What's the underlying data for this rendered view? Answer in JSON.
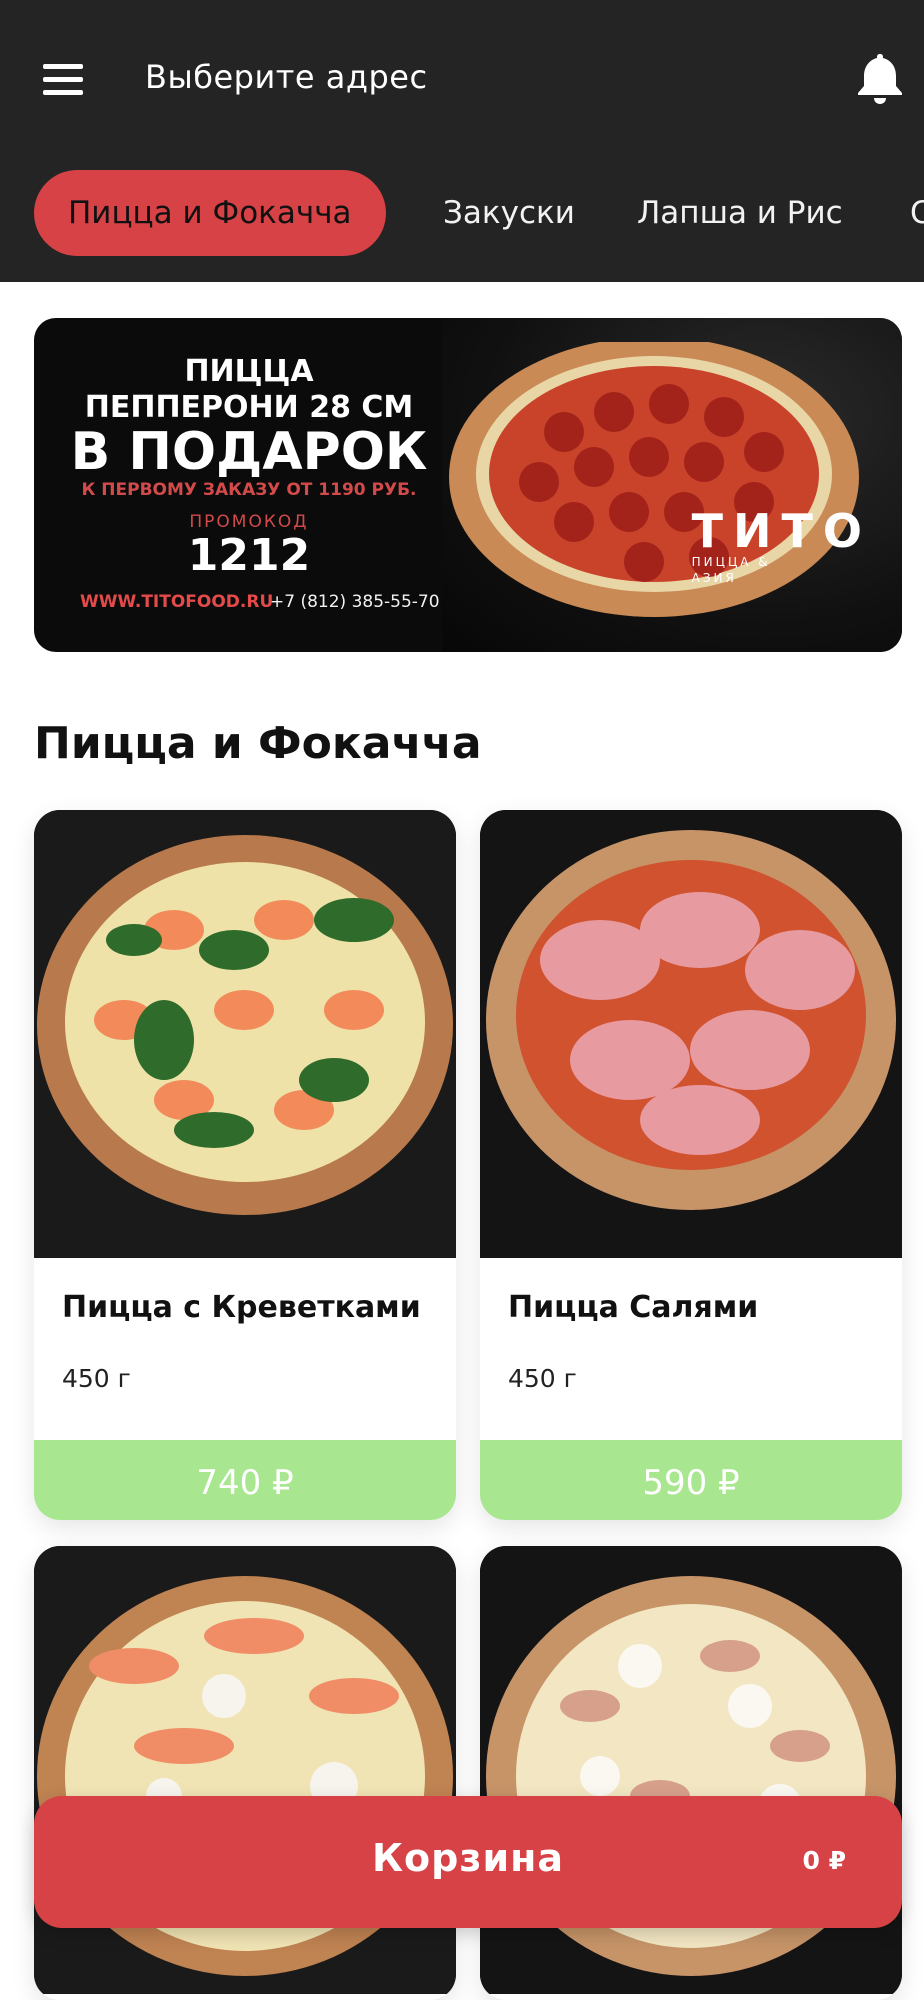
{
  "header": {
    "address_label": "Выберите адрес",
    "menu_icon": "menu-icon",
    "bell_icon": "bell-icon"
  },
  "tabs": [
    {
      "label": "Пицца и Фокачча",
      "active": true
    },
    {
      "label": "Закуски",
      "active": false
    },
    {
      "label": "Лапша и Рис",
      "active": false
    },
    {
      "label": "С",
      "active": false
    }
  ],
  "banner": {
    "line1": "ПИЦЦА",
    "line2": "ПЕППЕРОНИ 28 СМ",
    "line3": "В ПОДАРОК",
    "line4": "К ПЕРВОМУ ЗАКАЗУ ОТ 1190 РУБ.",
    "promo_label": "ПРОМОКОД",
    "promo_code": "1212",
    "website": "WWW.TITOFOOD.RU",
    "phone": "+7 (812) 385-55-70",
    "brand_name": "ТИТО",
    "brand_sub1": "ПИЦЦА &",
    "brand_sub2": "АЗИЯ"
  },
  "section": {
    "title": "Пицца и Фокачча"
  },
  "products": [
    {
      "name": "Пицца с Креветками",
      "weight": "450 г",
      "price": "740 ₽"
    },
    {
      "name": "Пицца Салями",
      "weight": "450 г",
      "price": "590 ₽"
    },
    {
      "name": "",
      "weight": "",
      "price": ""
    },
    {
      "name": "",
      "weight": "",
      "price": ""
    }
  ],
  "cart": {
    "label": "Корзина",
    "total": "0 ₽"
  },
  "colors": {
    "header_bg": "#242424",
    "accent_red": "#d64245",
    "price_green": "#a8e68f"
  }
}
